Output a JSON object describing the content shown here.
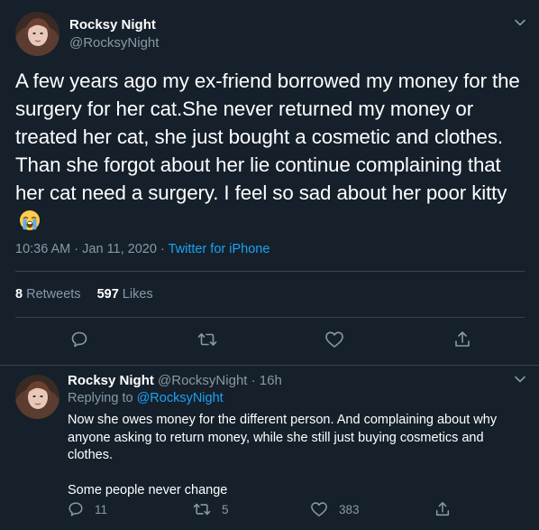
{
  "main_tweet": {
    "display_name": "Rocksy Night",
    "handle": "@RocksyNight",
    "text": "A few years ago my ex-friend borrowed my money for the surgery for her cat.She never returned my money or treated her cat, she just bought a cosmetic and clothes. Than she forgot about her lie continue complaining that her cat need a surgery. I feel so sad about her poor kitty",
    "emoji": "loudly-crying-face",
    "time": "10:36 AM",
    "separator": " · ",
    "date": "Jan 11, 2020",
    "source": "Twitter for iPhone",
    "retweets_count": "8",
    "retweets_label": "Retweets",
    "likes_count": "597",
    "likes_label": "Likes",
    "actions": [
      "reply-icon",
      "retweet-icon",
      "like-icon",
      "share-icon"
    ]
  },
  "reply_tweet": {
    "display_name": "Rocksy Night",
    "handle": "@RocksyNight",
    "age": "16h",
    "handle_age_separator": " · ",
    "replying_label": "Replying to",
    "replying_to": "@RocksyNight",
    "paragraph_1": "Now she owes money for the different person. And complaining about why anyone asking to return money, while she still just buying cosmetics and clothes.",
    "paragraph_2": "Some people never change",
    "reply_count": "11",
    "retweet_count": "5",
    "like_count": "383"
  },
  "colors": {
    "background": "#15202b",
    "primary_text": "#ffffff",
    "secondary_text": "#8899a6",
    "accent": "#1da1f2",
    "border": "#38444d"
  }
}
